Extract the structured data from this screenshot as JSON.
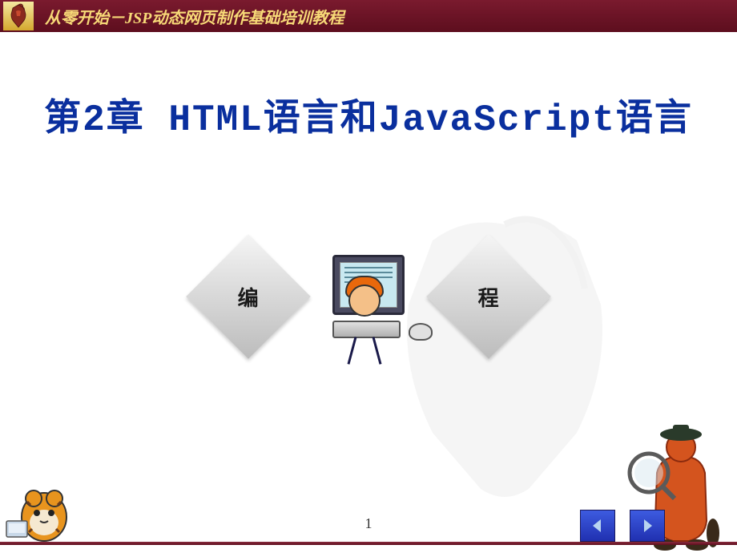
{
  "header": {
    "title": "从零开始－JSP动态网页制作基础培训教程"
  },
  "main": {
    "title": "第2章 HTML语言和JavaScript语言",
    "diamond_left": "编",
    "diamond_right": "程"
  },
  "footer": {
    "page_number": "1"
  }
}
